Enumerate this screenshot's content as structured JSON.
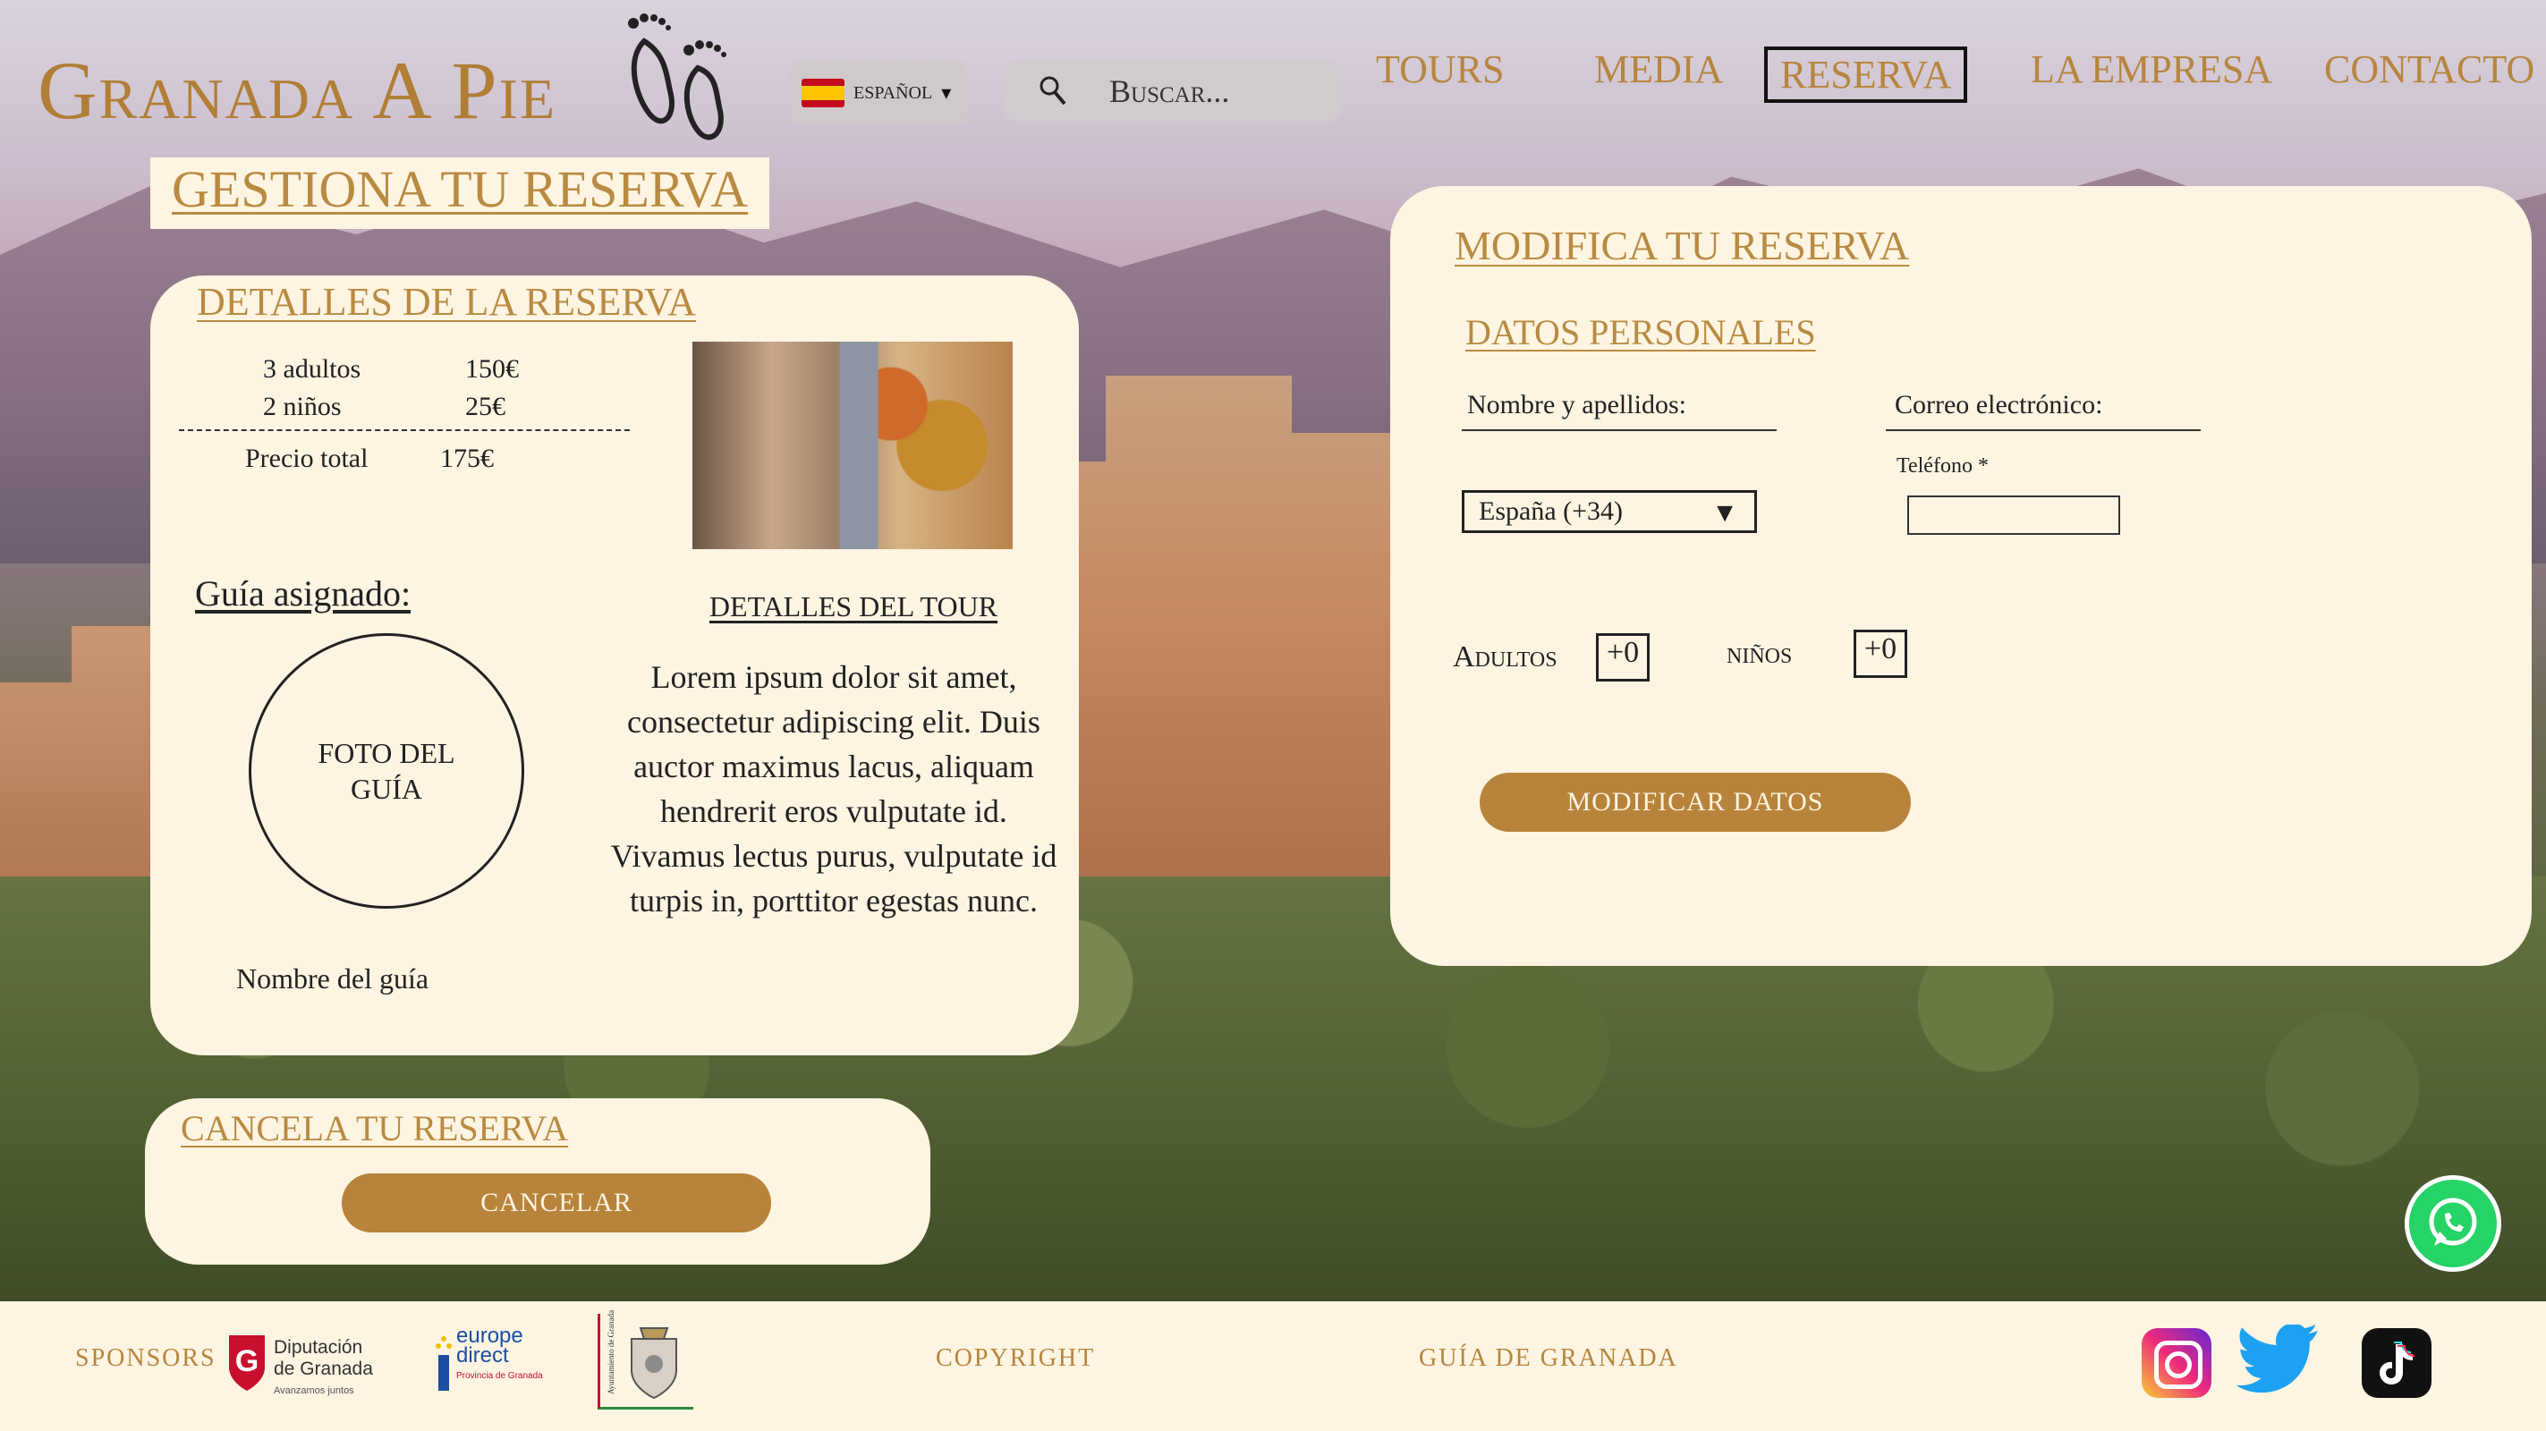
{
  "header": {
    "logo_text": "Granada A Pie",
    "language": {
      "flag": "es-flag-icon",
      "label": "ESPAÑOL"
    },
    "search": {
      "placeholder": "Buscar..."
    },
    "nav": [
      {
        "label": "TOURS",
        "active": false
      },
      {
        "label": "MEDIA",
        "active": false
      },
      {
        "label": "RESERVA",
        "active": true
      },
      {
        "label": "LA EMPRESA",
        "active": false
      },
      {
        "label": "CONTACTO",
        "active": false
      }
    ]
  },
  "page_title": "GESTIONA TU RESERVA",
  "details": {
    "title": "DETALLES DE LA RESERVA",
    "rows": [
      {
        "label": "3 adultos",
        "price": "150€"
      },
      {
        "label": "2 niños",
        "price": "25€"
      }
    ],
    "total": {
      "label": "Precio total",
      "price": "175€"
    },
    "guide_label": "Guía asignado:",
    "guide_photo": "FOTO DEL GUÍA",
    "guide_name": "Nombre del guía",
    "tour_title": "DETALLES DEL TOUR",
    "tour_description": "Lorem ipsum dolor sit amet, consectetur adipiscing elit. Duis auctor maximus lacus, aliquam hendrerit eros vulputate id. Vivamus lectus purus, vulputate id turpis in, porttitor egestas nunc."
  },
  "modify": {
    "title": "MODIFICA TU RESERVA",
    "section": "DATOS PERSONALES",
    "name_label": "Nombre y apellidos:",
    "email_label": "Correo electrónico:",
    "country_select": "España (+34)",
    "phone_label": "Teléfono *",
    "phone_value": "",
    "adults_label": "Adultos",
    "adults_value": "+0",
    "children_label": "niños",
    "children_value": "+0",
    "submit": "MODIFICAR DATOS"
  },
  "cancel": {
    "title": "CANCELA TU RESERVA",
    "button": "CANCELAR"
  },
  "footer": {
    "sponsors_label": "SPONSORS",
    "sponsors": [
      {
        "name": "Diputación de Granada",
        "tagline": "Avanzamos juntos"
      },
      {
        "name": "europe direct",
        "tagline": "Provincia de Granada"
      },
      {
        "name": "Ayuntamiento de Granada"
      }
    ],
    "copyright": "COPYRIGHT",
    "guide_link": "GUÍA DE GRANADA",
    "social": [
      "instagram-icon",
      "twitter-icon",
      "tiktok-icon"
    ]
  },
  "colors": {
    "accent": "#b7853e",
    "card": "#fdf4e2",
    "button": "#b8843b"
  }
}
